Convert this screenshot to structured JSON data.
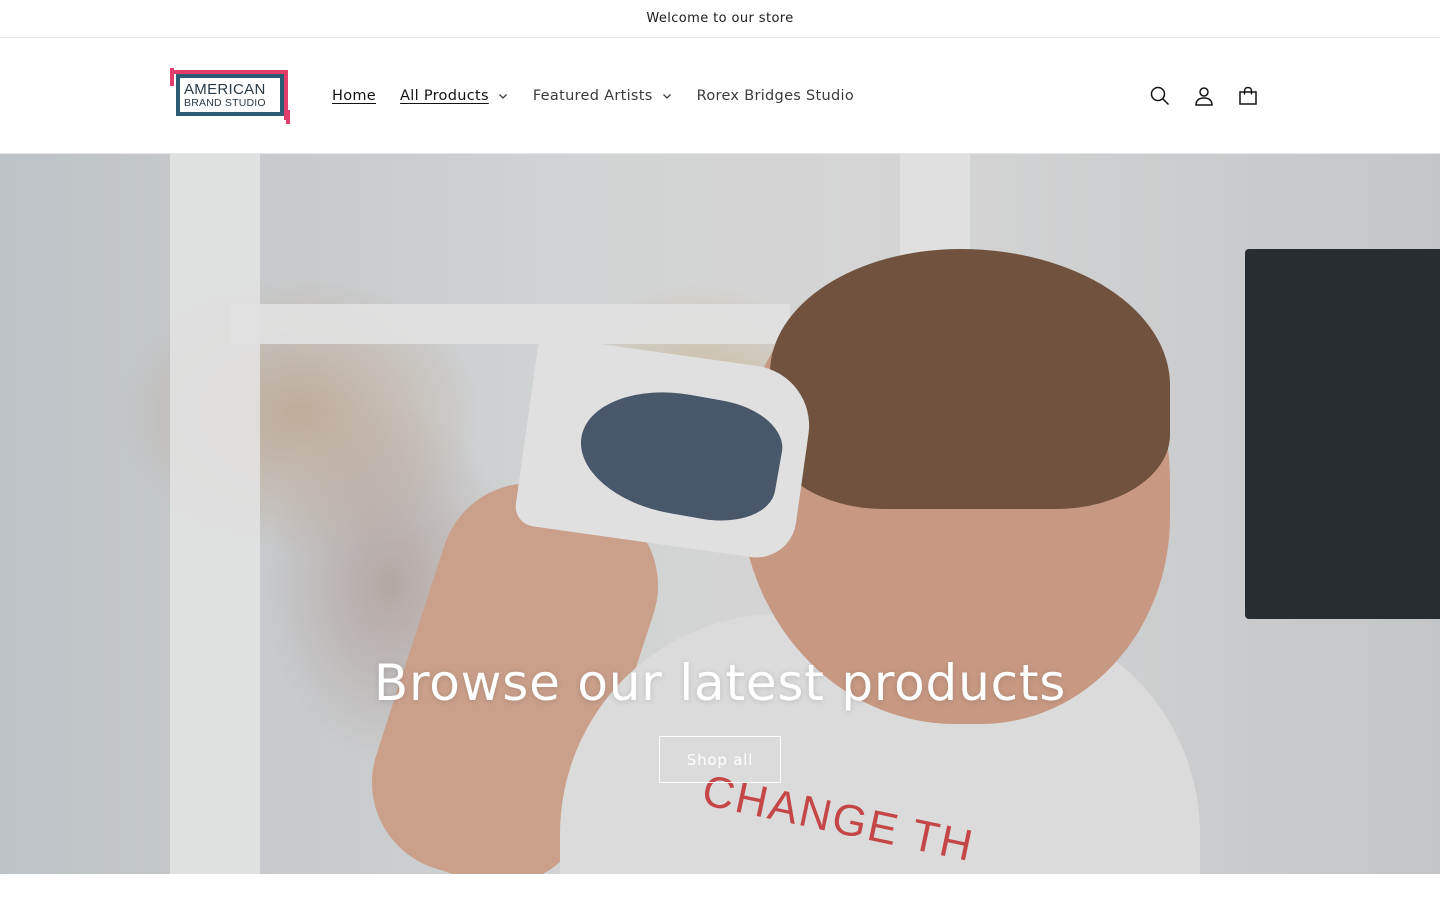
{
  "announcement": {
    "text": "Welcome to our store"
  },
  "header": {
    "logo": {
      "line1": "AMERICAN",
      "line2": "BRAND STUDIO"
    },
    "nav": [
      {
        "label": "Home",
        "underline": true,
        "dropdown": false
      },
      {
        "label": "All Products",
        "underline": true,
        "dropdown": true
      },
      {
        "label": "Featured Artists",
        "underline": false,
        "dropdown": true
      },
      {
        "label": "Rorex Bridges Studio",
        "underline": false,
        "dropdown": false
      }
    ],
    "icons": [
      "search-icon",
      "account-icon",
      "cart-icon"
    ]
  },
  "hero": {
    "title": "Browse our latest products",
    "button_label": "Shop all",
    "shirt_text": "CHANGE TH"
  },
  "colors": {
    "logo_blue": "#2a5d74",
    "logo_pink": "#e23c6a",
    "text_dark": "#121212"
  }
}
